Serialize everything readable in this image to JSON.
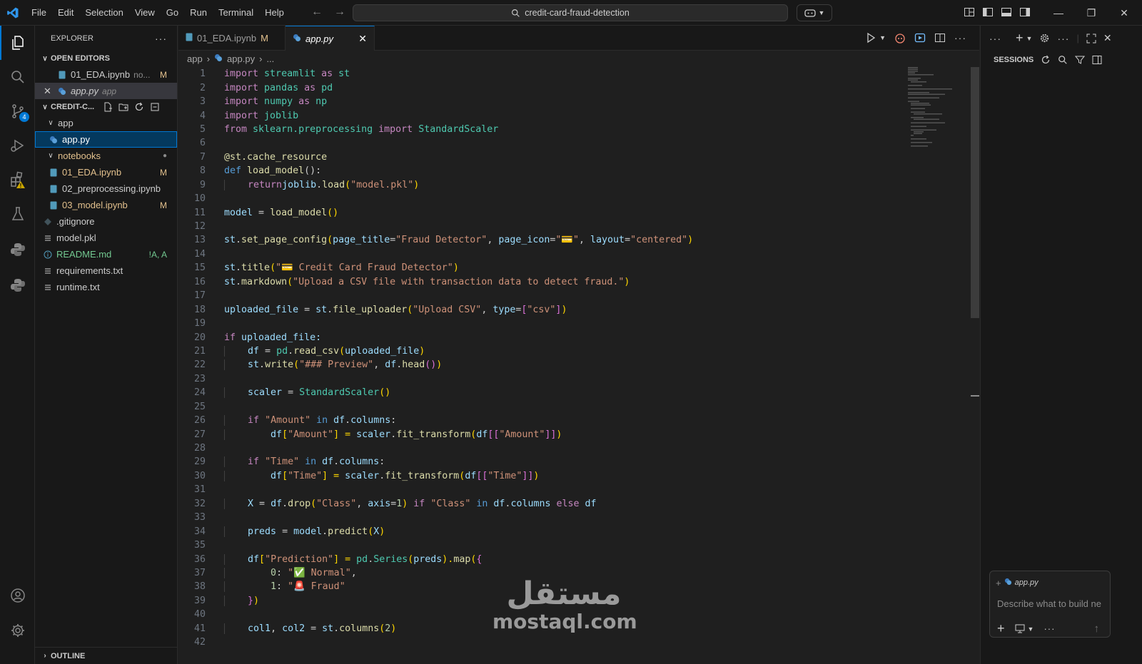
{
  "titlebar": {
    "menu": [
      "File",
      "Edit",
      "Selection",
      "View",
      "Go",
      "Run",
      "Terminal",
      "Help"
    ],
    "search": "credit-card-fraud-detection"
  },
  "activity": {
    "scm_badge": "4"
  },
  "explorer": {
    "title": "EXPLORER",
    "open_editors_label": "OPEN EDITORS",
    "open_editors": [
      {
        "name": "01_EDA.ipynb",
        "hint": "no...",
        "status": "M"
      },
      {
        "name": "app.py",
        "hint": "app",
        "status": ""
      }
    ],
    "project_label": "CREDIT-C...",
    "tree": [
      {
        "name": "app",
        "type": "folder",
        "status": ""
      },
      {
        "name": "app.py",
        "type": "py",
        "status": ""
      },
      {
        "name": "notebooks",
        "type": "folder",
        "status": "●"
      },
      {
        "name": "01_EDA.ipynb",
        "type": "nb",
        "status": "M"
      },
      {
        "name": "02_preprocessing.ipynb",
        "type": "nb",
        "status": ""
      },
      {
        "name": "03_model.ipynb",
        "type": "nb",
        "status": "M"
      },
      {
        "name": ".gitignore",
        "type": "git",
        "status": ""
      },
      {
        "name": "model.pkl",
        "type": "file",
        "status": ""
      },
      {
        "name": "README.md",
        "type": "info",
        "status": "!A, A"
      },
      {
        "name": "requirements.txt",
        "type": "file",
        "status": ""
      },
      {
        "name": "runtime.txt",
        "type": "file",
        "status": ""
      }
    ],
    "outline_label": "OUTLINE"
  },
  "tabs": [
    {
      "label": "01_EDA.ipynb",
      "status": "M"
    },
    {
      "label": "app.py",
      "status": ""
    }
  ],
  "breadcrumb": {
    "folder": "app",
    "file": "app.py",
    "more": "..."
  },
  "code_lines": [
    "1",
    "2",
    "3",
    "4",
    "5",
    "6",
    "7",
    "8",
    "9",
    "10",
    "11",
    "12",
    "13",
    "14",
    "15",
    "16",
    "17",
    "18",
    "19",
    "20",
    "21",
    "22",
    "23",
    "24",
    "25",
    "26",
    "27",
    "28",
    "29",
    "30",
    "31",
    "32",
    "33",
    "34",
    "35",
    "36",
    "37",
    "38",
    "39",
    "40",
    "41",
    "42"
  ],
  "code": {
    "l1": [
      "import",
      "streamlit",
      "as",
      "st"
    ],
    "l2": [
      "import",
      "pandas",
      "as",
      "pd"
    ],
    "l3": [
      "import",
      "numpy",
      "as",
      "np"
    ],
    "l4": [
      "import",
      "joblib"
    ],
    "l5": [
      "from",
      "sklearn.preprocessing",
      "import",
      "StandardScaler"
    ],
    "l7": [
      "@st.cache_resource"
    ],
    "l8": [
      "def",
      "load_model",
      "():"
    ],
    "l9": [
      "return",
      "joblib",
      ".",
      "load",
      "(",
      "\"model.pkl\"",
      ")"
    ],
    "l11": [
      "model",
      " = ",
      "load_model",
      "()"
    ],
    "l13": [
      "st",
      ".",
      "set_page_config",
      "(",
      "page_title",
      "=",
      "\"Fraud Detector\"",
      ", ",
      "page_icon",
      "=",
      "\"",
      "💳",
      "\"",
      ", ",
      "layout",
      "=",
      "\"centered\"",
      ")"
    ],
    "l15": [
      "st",
      ".",
      "title",
      "(",
      "\"",
      "💳",
      " Credit Card Fraud Detector\"",
      ")"
    ],
    "l16": [
      "st",
      ".",
      "markdown",
      "(",
      "\"Upload a CSV file with transaction data to detect fraud.\"",
      ")"
    ],
    "l18": [
      "uploaded_file",
      " = ",
      "st",
      ".",
      "file_uploader",
      "(",
      "\"Upload CSV\"",
      ", ",
      "type",
      "=",
      "[",
      "\"csv\"",
      "]",
      ")"
    ],
    "l20": [
      "if",
      " uploaded_file:"
    ],
    "l21": [
      "df",
      " = ",
      "pd",
      ".",
      "read_csv",
      "(",
      "uploaded_file",
      ")"
    ],
    "l22": [
      "st",
      ".",
      "write",
      "(",
      "\"### Preview\"",
      ", ",
      "df",
      ".",
      "head",
      "()",
      ")"
    ],
    "l24": [
      "scaler",
      " = ",
      "StandardScaler",
      "()"
    ],
    "l26": [
      "if",
      " ",
      "\"Amount\"",
      " in ",
      "df",
      ".",
      "columns",
      ":"
    ],
    "l27": [
      "df",
      "[",
      "\"Amount\"",
      "] = ",
      "scaler",
      ".",
      "fit_transform",
      "(",
      "df",
      "[[",
      "\"Amount\"",
      "]]",
      ")"
    ],
    "l29": [
      "if",
      " ",
      "\"Time\"",
      " in ",
      "df",
      ".",
      "columns",
      ":"
    ],
    "l30": [
      "df",
      "[",
      "\"Time\"",
      "] = ",
      "scaler",
      ".",
      "fit_transform",
      "(",
      "df",
      "[[",
      "\"Time\"",
      "]]",
      ")"
    ],
    "l32": [
      "X",
      " = ",
      "df",
      ".",
      "drop",
      "(",
      "\"Class\"",
      ", ",
      "axis",
      "=",
      "1",
      ") ",
      "if",
      " ",
      "\"Class\"",
      " in ",
      "df",
      ".",
      "columns",
      " else ",
      "df"
    ],
    "l34": [
      "preds",
      " = ",
      "model",
      ".",
      "predict",
      "(",
      "X",
      ")"
    ],
    "l36": [
      "df",
      "[",
      "\"Prediction\"",
      "] = ",
      "pd",
      ".",
      "Series",
      "(",
      "preds",
      ").",
      "map",
      "(",
      "{"
    ],
    "l37": [
      "0",
      ": ",
      "\"",
      "✅",
      " Normal\"",
      ","
    ],
    "l38": [
      "1",
      ": ",
      "\"",
      "🚨",
      " Fraud\""
    ],
    "l39": [
      "}",
      ")"
    ],
    "l41": [
      "col1",
      ", ",
      "col2",
      " = ",
      "st",
      ".",
      "columns",
      "(",
      "2",
      ")"
    ]
  },
  "chat": {
    "sessions_label": "SESSIONS",
    "context_file": "app.py",
    "placeholder": "Describe what to build ne"
  },
  "watermark": {
    "arabic": "مستقل",
    "latin": "mostaql.com"
  }
}
